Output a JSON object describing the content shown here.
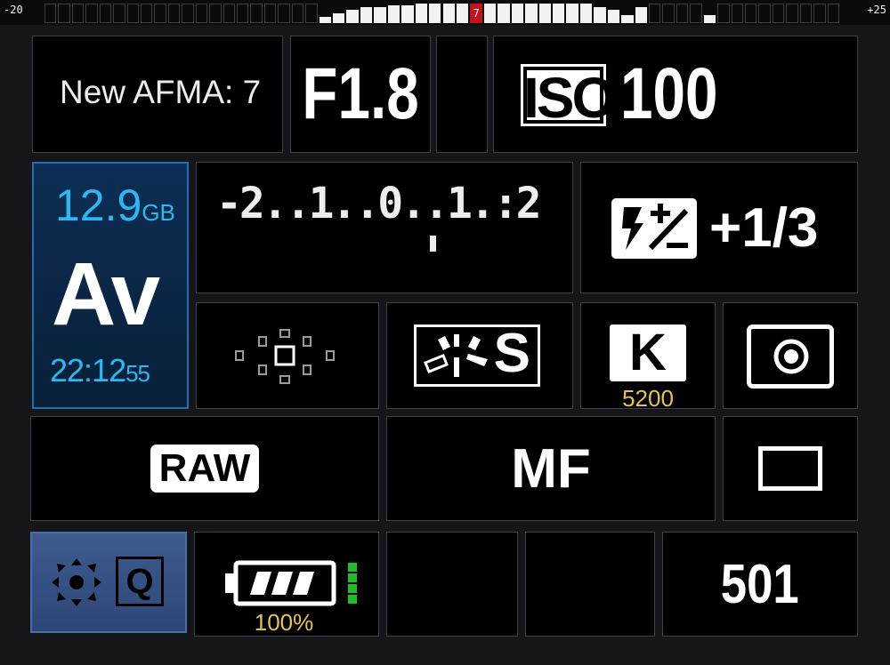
{
  "exposure_scale": {
    "min_label": "-20",
    "max_label": "+25",
    "marker_label": "7",
    "histogram_levels": [
      0,
      0,
      0,
      0,
      0,
      0,
      0,
      0,
      0,
      0,
      0,
      0,
      0,
      0,
      0,
      0,
      0,
      0,
      0,
      0,
      0.3,
      0.5,
      0.7,
      0.8,
      0.8,
      0.9,
      0.9,
      1,
      1,
      1,
      1,
      0,
      1,
      1,
      1,
      1,
      1,
      1,
      1,
      1,
      0.8,
      0.7,
      0.4,
      0.8,
      0,
      0,
      0,
      0,
      0.4,
      0,
      0,
      0,
      0,
      0,
      0,
      0,
      0,
      0
    ]
  },
  "afma": {
    "label": "New AFMA: 7"
  },
  "aperture": {
    "value": "F1.8"
  },
  "iso": {
    "badge": "ISO",
    "value": "100"
  },
  "status": {
    "storage_value": "12.9",
    "storage_unit": "GB",
    "mode": "Av",
    "time_main": "22:12",
    "time_seconds": "55"
  },
  "exposure_comp": {
    "scale_text": "-2..1..0..1.:2",
    "level": 0.5
  },
  "flash_comp": {
    "icon": "flash-exposure-compensation-icon",
    "value": "+1/3"
  },
  "af_point": {
    "icon": "af-point-selection-icon"
  },
  "picture_style": {
    "icon": "picture-style-standard-icon",
    "letter": "S"
  },
  "white_balance": {
    "badge": "K",
    "value": "5200"
  },
  "metering": {
    "icon": "evaluative-metering-icon"
  },
  "quality": {
    "badge": "RAW"
  },
  "focus_mode": {
    "label": "MF"
  },
  "drive_mode": {
    "icon": "single-shot-drive-icon"
  },
  "quick_control": {
    "badge": "Q",
    "icon": "multi-controller-icon"
  },
  "battery": {
    "percent_label": "100%",
    "level": 1.0
  },
  "shots_remaining": {
    "value": "501"
  },
  "colors": {
    "accent_blue": "#2cb8f0",
    "warn_yellow": "#e6c34a",
    "marker_red": "#c2121c",
    "battery_green": "#1fbf2b"
  }
}
